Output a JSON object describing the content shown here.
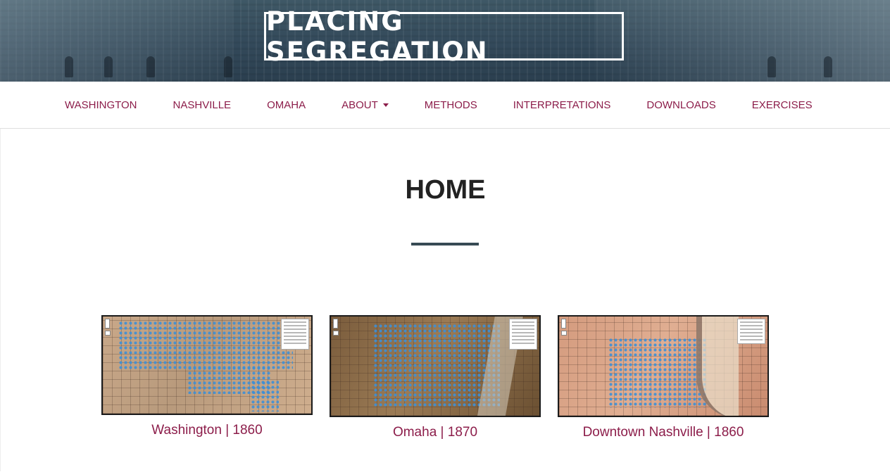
{
  "site": {
    "title": "PLACING SEGREGATION"
  },
  "nav": {
    "items": [
      {
        "label": "WASHINGTON"
      },
      {
        "label": "NASHVILLE"
      },
      {
        "label": "OMAHA"
      },
      {
        "label": "ABOUT",
        "dropdown": true
      },
      {
        "label": "METHODS"
      },
      {
        "label": "INTERPRETATIONS"
      },
      {
        "label": "DOWNLOADS"
      },
      {
        "label": "EXERCISES"
      }
    ]
  },
  "main": {
    "title": "HOME",
    "cards": [
      {
        "caption": "Washington | 1860",
        "image": "washington-1860-map"
      },
      {
        "caption": "Omaha | 1870",
        "image": "omaha-1870-map"
      },
      {
        "caption": "Downtown Nashville | 1860",
        "image": "nashville-1860-map"
      }
    ]
  },
  "colors": {
    "accent": "#8c1d4a",
    "banner": "#33495a",
    "divider": "#374a54",
    "title": "#222222"
  }
}
